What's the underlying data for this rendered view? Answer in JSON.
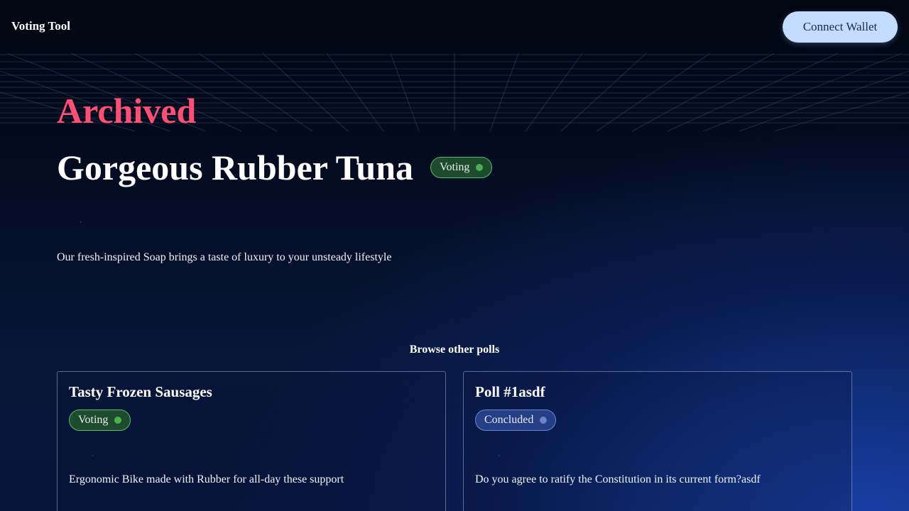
{
  "header": {
    "brand": "Voting Tool",
    "connect_wallet_label": "Connect Wallet"
  },
  "poll": {
    "kicker": "Archived",
    "title": "Gorgeous Rubber Tuna",
    "status": "Voting",
    "tick": "`",
    "description": "Our fresh-inspired Soap brings a taste of luxury to your unsteady lifestyle"
  },
  "browse": {
    "heading": "Browse other polls",
    "polls": [
      {
        "title": "Tasty Frozen Sausages",
        "status": "Voting",
        "tick": "`",
        "description": "Ergonomic Bike made with Rubber for all-day these support"
      },
      {
        "title": "Poll #1asdf",
        "status": "Concluded",
        "tick": "`",
        "description": "Do you agree to ratify the Constitution in its current form?asdf"
      }
    ]
  },
  "colors": {
    "accent_pink": "#ff4f75",
    "wallet_button": "#c4dcff",
    "voting_green": "#4caf50",
    "concluded_blue": "#6c84cc"
  },
  "icons": {
    "voting_status": "green-dot-icon",
    "concluded_status": "blue-dot-icon"
  }
}
